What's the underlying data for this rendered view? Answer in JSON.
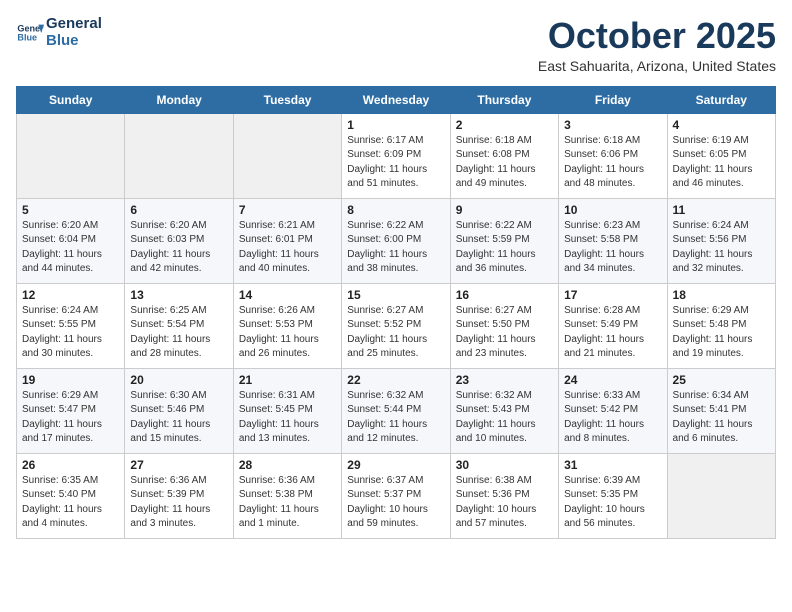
{
  "header": {
    "logo_line1": "General",
    "logo_line2": "Blue",
    "month": "October 2025",
    "location": "East Sahuarita, Arizona, United States"
  },
  "weekdays": [
    "Sunday",
    "Monday",
    "Tuesday",
    "Wednesday",
    "Thursday",
    "Friday",
    "Saturday"
  ],
  "weeks": [
    [
      {
        "day": "",
        "info": ""
      },
      {
        "day": "",
        "info": ""
      },
      {
        "day": "",
        "info": ""
      },
      {
        "day": "1",
        "info": "Sunrise: 6:17 AM\nSunset: 6:09 PM\nDaylight: 11 hours\nand 51 minutes."
      },
      {
        "day": "2",
        "info": "Sunrise: 6:18 AM\nSunset: 6:08 PM\nDaylight: 11 hours\nand 49 minutes."
      },
      {
        "day": "3",
        "info": "Sunrise: 6:18 AM\nSunset: 6:06 PM\nDaylight: 11 hours\nand 48 minutes."
      },
      {
        "day": "4",
        "info": "Sunrise: 6:19 AM\nSunset: 6:05 PM\nDaylight: 11 hours\nand 46 minutes."
      }
    ],
    [
      {
        "day": "5",
        "info": "Sunrise: 6:20 AM\nSunset: 6:04 PM\nDaylight: 11 hours\nand 44 minutes."
      },
      {
        "day": "6",
        "info": "Sunrise: 6:20 AM\nSunset: 6:03 PM\nDaylight: 11 hours\nand 42 minutes."
      },
      {
        "day": "7",
        "info": "Sunrise: 6:21 AM\nSunset: 6:01 PM\nDaylight: 11 hours\nand 40 minutes."
      },
      {
        "day": "8",
        "info": "Sunrise: 6:22 AM\nSunset: 6:00 PM\nDaylight: 11 hours\nand 38 minutes."
      },
      {
        "day": "9",
        "info": "Sunrise: 6:22 AM\nSunset: 5:59 PM\nDaylight: 11 hours\nand 36 minutes."
      },
      {
        "day": "10",
        "info": "Sunrise: 6:23 AM\nSunset: 5:58 PM\nDaylight: 11 hours\nand 34 minutes."
      },
      {
        "day": "11",
        "info": "Sunrise: 6:24 AM\nSunset: 5:56 PM\nDaylight: 11 hours\nand 32 minutes."
      }
    ],
    [
      {
        "day": "12",
        "info": "Sunrise: 6:24 AM\nSunset: 5:55 PM\nDaylight: 11 hours\nand 30 minutes."
      },
      {
        "day": "13",
        "info": "Sunrise: 6:25 AM\nSunset: 5:54 PM\nDaylight: 11 hours\nand 28 minutes."
      },
      {
        "day": "14",
        "info": "Sunrise: 6:26 AM\nSunset: 5:53 PM\nDaylight: 11 hours\nand 26 minutes."
      },
      {
        "day": "15",
        "info": "Sunrise: 6:27 AM\nSunset: 5:52 PM\nDaylight: 11 hours\nand 25 minutes."
      },
      {
        "day": "16",
        "info": "Sunrise: 6:27 AM\nSunset: 5:50 PM\nDaylight: 11 hours\nand 23 minutes."
      },
      {
        "day": "17",
        "info": "Sunrise: 6:28 AM\nSunset: 5:49 PM\nDaylight: 11 hours\nand 21 minutes."
      },
      {
        "day": "18",
        "info": "Sunrise: 6:29 AM\nSunset: 5:48 PM\nDaylight: 11 hours\nand 19 minutes."
      }
    ],
    [
      {
        "day": "19",
        "info": "Sunrise: 6:29 AM\nSunset: 5:47 PM\nDaylight: 11 hours\nand 17 minutes."
      },
      {
        "day": "20",
        "info": "Sunrise: 6:30 AM\nSunset: 5:46 PM\nDaylight: 11 hours\nand 15 minutes."
      },
      {
        "day": "21",
        "info": "Sunrise: 6:31 AM\nSunset: 5:45 PM\nDaylight: 11 hours\nand 13 minutes."
      },
      {
        "day": "22",
        "info": "Sunrise: 6:32 AM\nSunset: 5:44 PM\nDaylight: 11 hours\nand 12 minutes."
      },
      {
        "day": "23",
        "info": "Sunrise: 6:32 AM\nSunset: 5:43 PM\nDaylight: 11 hours\nand 10 minutes."
      },
      {
        "day": "24",
        "info": "Sunrise: 6:33 AM\nSunset: 5:42 PM\nDaylight: 11 hours\nand 8 minutes."
      },
      {
        "day": "25",
        "info": "Sunrise: 6:34 AM\nSunset: 5:41 PM\nDaylight: 11 hours\nand 6 minutes."
      }
    ],
    [
      {
        "day": "26",
        "info": "Sunrise: 6:35 AM\nSunset: 5:40 PM\nDaylight: 11 hours\nand 4 minutes."
      },
      {
        "day": "27",
        "info": "Sunrise: 6:36 AM\nSunset: 5:39 PM\nDaylight: 11 hours\nand 3 minutes."
      },
      {
        "day": "28",
        "info": "Sunrise: 6:36 AM\nSunset: 5:38 PM\nDaylight: 11 hours\nand 1 minute."
      },
      {
        "day": "29",
        "info": "Sunrise: 6:37 AM\nSunset: 5:37 PM\nDaylight: 10 hours\nand 59 minutes."
      },
      {
        "day": "30",
        "info": "Sunrise: 6:38 AM\nSunset: 5:36 PM\nDaylight: 10 hours\nand 57 minutes."
      },
      {
        "day": "31",
        "info": "Sunrise: 6:39 AM\nSunset: 5:35 PM\nDaylight: 10 hours\nand 56 minutes."
      },
      {
        "day": "",
        "info": ""
      }
    ]
  ]
}
